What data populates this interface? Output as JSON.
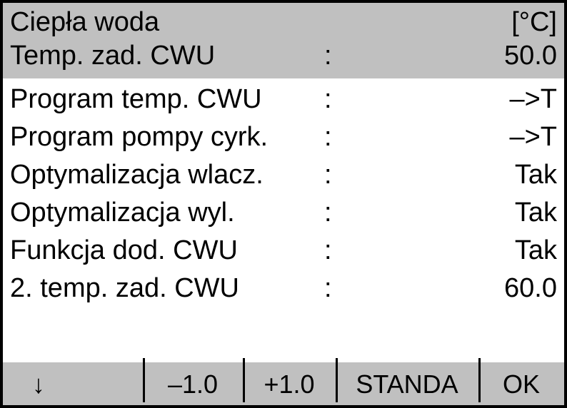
{
  "header": {
    "title": "Ciepła woda",
    "unit": "[°C]",
    "setpoint_label": "Temp. zad. CWU",
    "setpoint_value": "50.0"
  },
  "rows": [
    {
      "label": "Program temp. CWU",
      "value": "–>T"
    },
    {
      "label": "Program pompy cyrk.",
      "value": "–>T"
    },
    {
      "label": "Optymalizacja wlacz.",
      "value": "Tak"
    },
    {
      "label": "Optymalizacja wyl.",
      "value": "Tak"
    },
    {
      "label": "Funkcja dod. CWU",
      "value": "Tak"
    },
    {
      "label": "2. temp. zad. CWU",
      "value": "60.0"
    }
  ],
  "footer": {
    "down": "↓",
    "minus": "–1.0",
    "plus": "+1.0",
    "standa": "STANDA",
    "ok": "OK"
  }
}
